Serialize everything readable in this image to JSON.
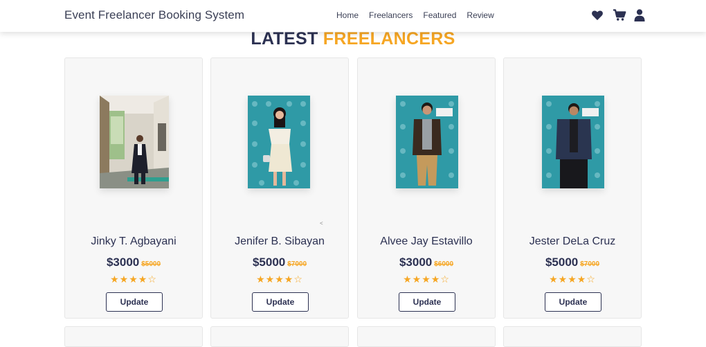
{
  "navbar": {
    "brand": "Event Freelancer Booking System",
    "links": [
      "Home",
      "Freelancers",
      "Featured",
      "Review"
    ],
    "icons": [
      "heart-icon",
      "cart-icon",
      "user-icon"
    ]
  },
  "section": {
    "title_part1": "LATEST",
    "title_part2": "FREELANCERS"
  },
  "colors": {
    "navy": "#2c3152",
    "accent": "#f6a623",
    "card_bg": "#f7f7f7"
  },
  "freelancers": [
    {
      "name": "Jinky T. Agbayani",
      "price": "$3000",
      "old_price": "$5000",
      "stars": "★★★★☆",
      "rating": 4,
      "button": "Update"
    },
    {
      "name": "Jenifer B. Sibayan",
      "price": "$5000",
      "old_price": "$7000",
      "stars": "★★★★☆",
      "rating": 4,
      "button": "Update"
    },
    {
      "name": "Alvee Jay Estavillo",
      "price": "$3000",
      "old_price": "$6000",
      "stars": "★★★★☆",
      "rating": 4,
      "button": "Update"
    },
    {
      "name": "Jester DeLa Cruz",
      "price": "$5000",
      "old_price": "$7000",
      "stars": "★★★★☆",
      "rating": 4,
      "button": "Update"
    }
  ],
  "misc": {
    "caret": "<"
  }
}
